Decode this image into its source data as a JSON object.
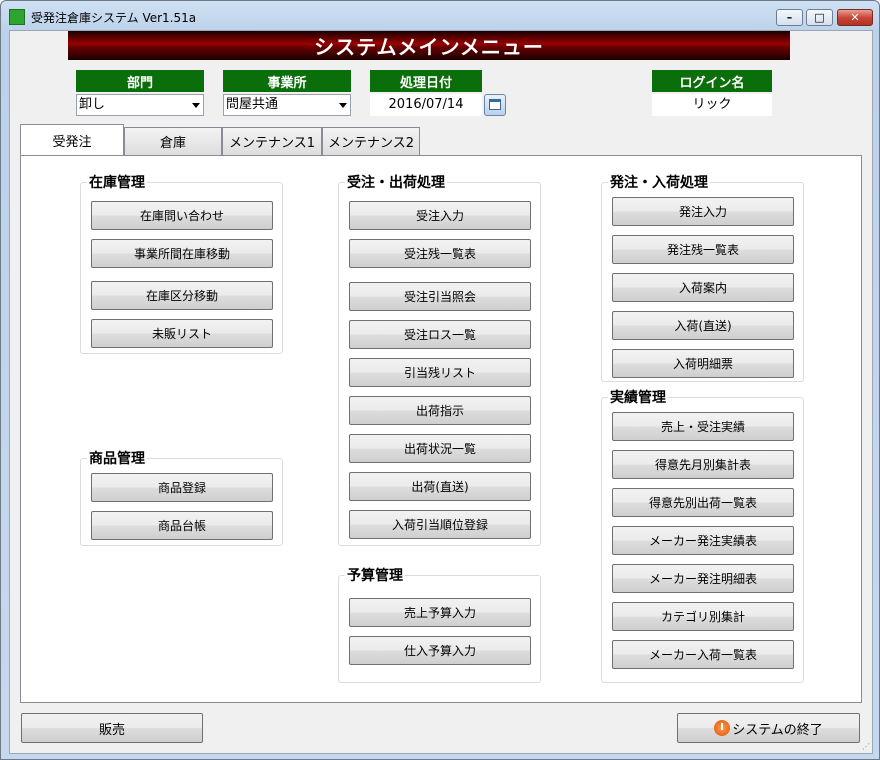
{
  "window": {
    "title": "受発注倉庫システム Ver1.51a"
  },
  "banner": {
    "text": "システムメインメニュー"
  },
  "fields": {
    "department": {
      "label": "部門",
      "value": "卸し"
    },
    "office": {
      "label": "事業所",
      "value": "問屋共通"
    },
    "date": {
      "label": "処理日付",
      "value": "2016/07/14"
    },
    "login": {
      "label": "ログイン名",
      "value": "リック"
    }
  },
  "tabs": [
    "受発注",
    "倉庫",
    "メンテナンス1",
    "メンテナンス2"
  ],
  "active_tab": "受発注",
  "groups": {
    "inventory": {
      "title": "在庫管理",
      "buttons": [
        "在庫問い合わせ",
        "事業所間在庫移動",
        "在庫区分移動",
        "未販リスト"
      ]
    },
    "product": {
      "title": "商品管理",
      "buttons": [
        "商品登録",
        "商品台帳"
      ]
    },
    "order_shipping": {
      "title": "受注・出荷処理",
      "buttons": [
        "受注入力",
        "受注残一覧表",
        "受注引当照会",
        "受注ロス一覧",
        "引当残リスト",
        "出荷指示",
        "出荷状況一覧",
        "出荷(直送)",
        "入荷引当順位登録"
      ]
    },
    "budget": {
      "title": "予算管理",
      "buttons": [
        "売上予算入力",
        "仕入予算入力"
      ]
    },
    "purchase_receiving": {
      "title": "発注・入荷処理",
      "buttons": [
        "発注入力",
        "発注残一覧表",
        "入荷案内",
        "入荷(直送)",
        "入荷明細票"
      ]
    },
    "results": {
      "title": "実績管理",
      "buttons": [
        "売上・受注実績",
        "得意先月別集計表",
        "得意先別出荷一覧表",
        "メーカー発注実績表",
        "メーカー発注明細表",
        "カテゴリ別集計",
        "メーカー入荷一覧表"
      ]
    }
  },
  "footer": {
    "sales_button": "販売",
    "exit_button": "システムの終了"
  },
  "colors": {
    "banner": "#8b0000",
    "label_bg": "#0a6e0a"
  }
}
